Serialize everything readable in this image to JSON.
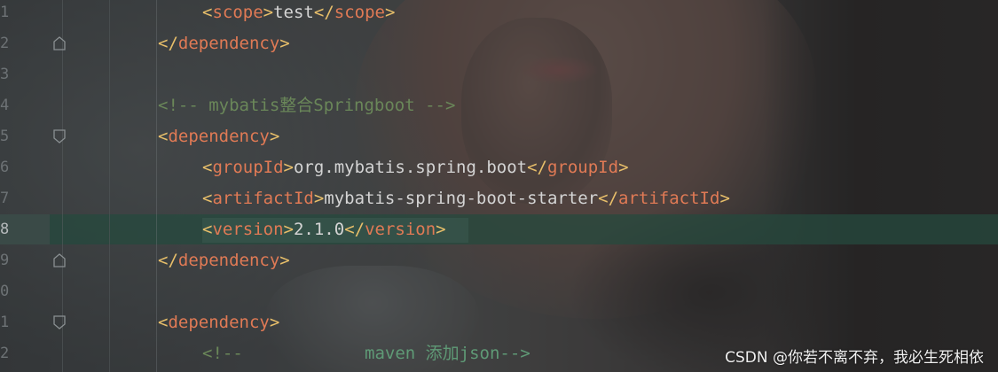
{
  "editor": {
    "lines": [
      {
        "num": "1",
        "indent": 2,
        "kind": "element",
        "open": "scope",
        "text": "test",
        "close": "scope",
        "fold": ""
      },
      {
        "num": "2",
        "indent": 1,
        "kind": "close",
        "tag": "dependency",
        "fold": "end"
      },
      {
        "num": "3",
        "indent": 0,
        "kind": "empty",
        "fold": ""
      },
      {
        "num": "4",
        "indent": 1,
        "kind": "comment",
        "text": "<!-- mybatis整合Springboot -->",
        "fold": ""
      },
      {
        "num": "5",
        "indent": 1,
        "kind": "open",
        "tag": "dependency",
        "fold": "start"
      },
      {
        "num": "6",
        "indent": 2,
        "kind": "element",
        "open": "groupId",
        "text": "org.mybatis.spring.boot",
        "close": "groupId",
        "fold": ""
      },
      {
        "num": "7",
        "indent": 2,
        "kind": "element",
        "open": "artifactId",
        "text": "mybatis-spring-boot-starter",
        "close": "artifactId",
        "fold": ""
      },
      {
        "num": "8",
        "indent": 2,
        "kind": "element",
        "open": "version",
        "text": "2.1.0",
        "close": "version",
        "fold": "",
        "current": true
      },
      {
        "num": "9",
        "indent": 1,
        "kind": "close",
        "tag": "dependency",
        "fold": "end"
      },
      {
        "num": "0",
        "indent": 0,
        "kind": "empty",
        "fold": ""
      },
      {
        "num": "1",
        "indent": 1,
        "kind": "open",
        "tag": "dependency",
        "fold": "start"
      },
      {
        "num": "2",
        "indent": 2,
        "kind": "comment2",
        "text_a": "<!--",
        "text_b": "maven 添加json-->",
        "fold": ""
      }
    ]
  },
  "watermark": "CSDN @你若不离不弃，我必生死相依",
  "colors": {
    "tag_bracket": "#e8bf6a",
    "tag_name": "#e07a55",
    "text": "#d4d4d4",
    "comment": "#6a8759",
    "current_line": "#264a3e"
  }
}
